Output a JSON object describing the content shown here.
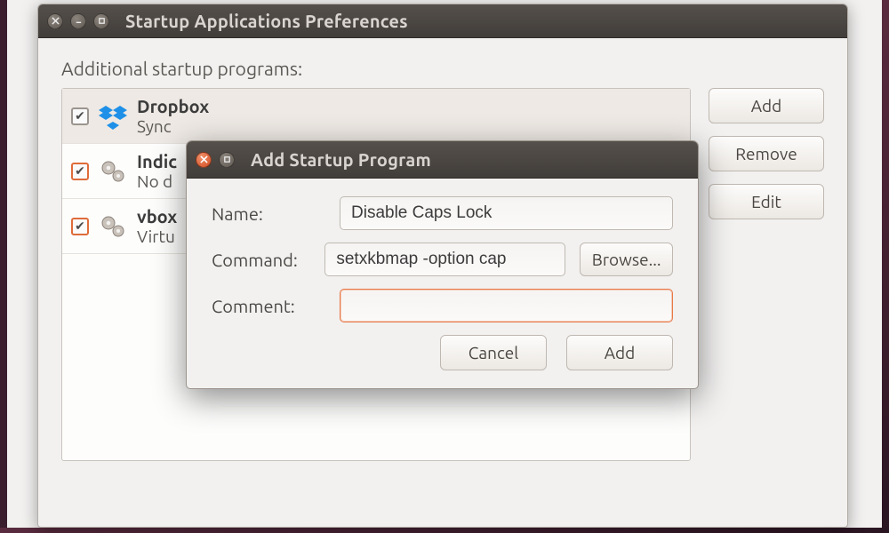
{
  "mainWindow": {
    "title": "Startup Applications Preferences",
    "sectionLabel": "Additional startup programs:",
    "buttons": {
      "add": "Add",
      "remove": "Remove",
      "edit": "Edit"
    },
    "items": [
      {
        "title": "Dropbox",
        "sub": "Sync",
        "checked": true,
        "iconName": "dropbox-icon"
      },
      {
        "title": "Indic",
        "sub": "No d",
        "checked": true,
        "iconName": "gears-icon"
      },
      {
        "title": "vbox",
        "sub": "Virtu",
        "checked": true,
        "iconName": "gears-icon"
      }
    ]
  },
  "dialog": {
    "title": "Add Startup Program",
    "labels": {
      "name": "Name:",
      "command": "Command:",
      "comment": "Comment:",
      "browse": "Browse...",
      "cancel": "Cancel",
      "add": "Add"
    },
    "values": {
      "name": "Disable Caps Lock",
      "command": "setxkbmap -option cap",
      "comment": ""
    }
  }
}
